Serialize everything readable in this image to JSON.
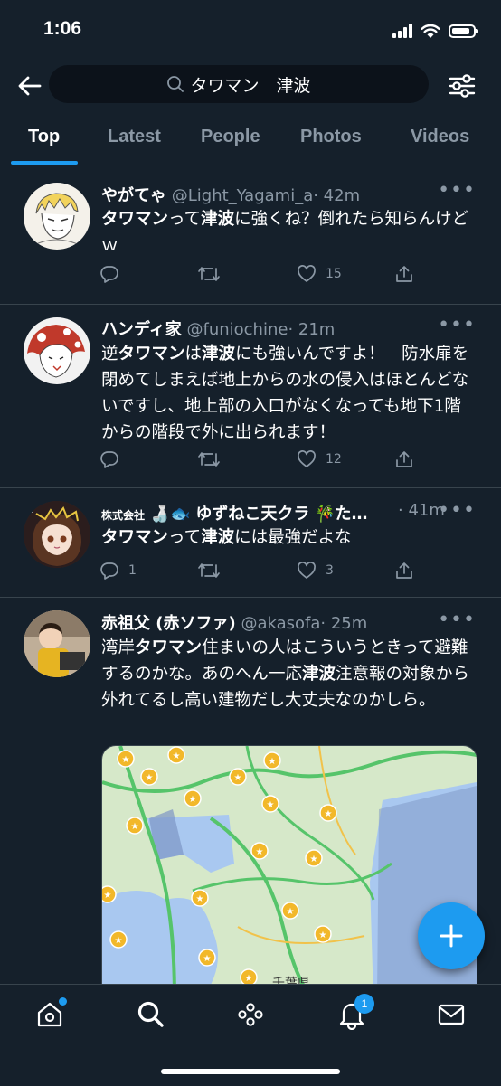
{
  "status_bar": {
    "time": "1:06"
  },
  "search": {
    "query": "タワマン　津波"
  },
  "tabs": [
    {
      "label": "Top",
      "active": true
    },
    {
      "label": "Latest"
    },
    {
      "label": "People"
    },
    {
      "label": "Photos"
    },
    {
      "label": "Videos"
    }
  ],
  "tweets": [
    {
      "name": "やがてゃ",
      "handle": "@Light_Yagami_a",
      "time": "· 42m",
      "text": [
        "タワマン",
        "って",
        "津波",
        "に強くね？倒れたら知らんけどｗ"
      ],
      "replies": "",
      "retweets": "",
      "likes": "15"
    },
    {
      "name": "ハンディ家",
      "handle": "@funiochine",
      "time": "· 21m",
      "text": [
        "逆",
        "タワマン",
        "は",
        "津波",
        "にも強いんですよ！　防水扉を閉めてしまえば地上からの水の侵入はほとんどないですし、地上部の入口がなくなっても地下1階からの階段で外に出られます！"
      ],
      "replies": "",
      "retweets": "",
      "likes": "12"
    },
    {
      "name": "ゆずねこ天クラ",
      "name_prefix": "株式会社",
      "name_suffix": "た…",
      "handle": "",
      "time": "· 41m",
      "text": [
        "タワマン",
        "って",
        "津波",
        "には最強だよな"
      ],
      "replies": "1",
      "retweets": "",
      "likes": "3"
    },
    {
      "name": "赤祖父 (赤ソファ)",
      "handle": "@akasofa",
      "time": "· 25m",
      "text": [
        "湾岸",
        "タワマン",
        "住まいの人はこういうときって避難するのかな。あのへん一応",
        "津波",
        "注意報の対象から外れてるし高い建物だし大丈夫なのかしら。"
      ],
      "map_label": "千葉県"
    }
  ],
  "more_glyph": "•••",
  "notifications_badge": "1",
  "colors": {
    "accent": "#1d9bf0",
    "background": "#15202b",
    "muted": "#8b98a5",
    "divider": "#38444d"
  }
}
